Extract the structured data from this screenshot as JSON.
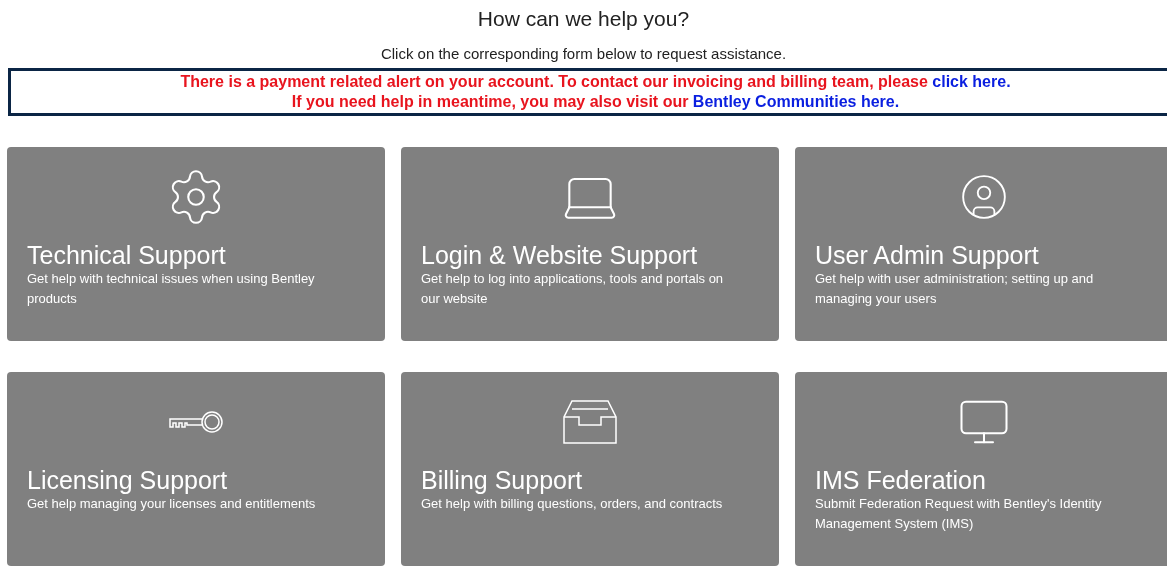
{
  "heading": "How can we help you?",
  "subheading": "Click on the corresponding form below to request assistance.",
  "alert": {
    "lines": [
      {
        "text": "There is a payment related alert on your account. To contact our invoicing and billing team, please ",
        "link": "click here."
      },
      {
        "text": "If you need help in meantime, you may also visit our ",
        "link": "Bentley Communities here."
      }
    ]
  },
  "cards": [
    {
      "title": "Technical Support",
      "description": "Get help with technical issues when using Bentley products"
    },
    {
      "title": "Login & Website Support",
      "description": "Get help to log into applications, tools and portals on our website"
    },
    {
      "title": "User Admin Support",
      "description": "Get help with user administration; setting up and managing your users"
    },
    {
      "title": "Licensing Support",
      "description": "Get help managing your licenses and entitlements"
    },
    {
      "title": "Billing Support",
      "description": "Get help with billing questions, orders, and contracts"
    },
    {
      "title": "IMS Federation",
      "description": "Submit Federation Request with Bentley's Identity Management System (IMS)"
    }
  ]
}
